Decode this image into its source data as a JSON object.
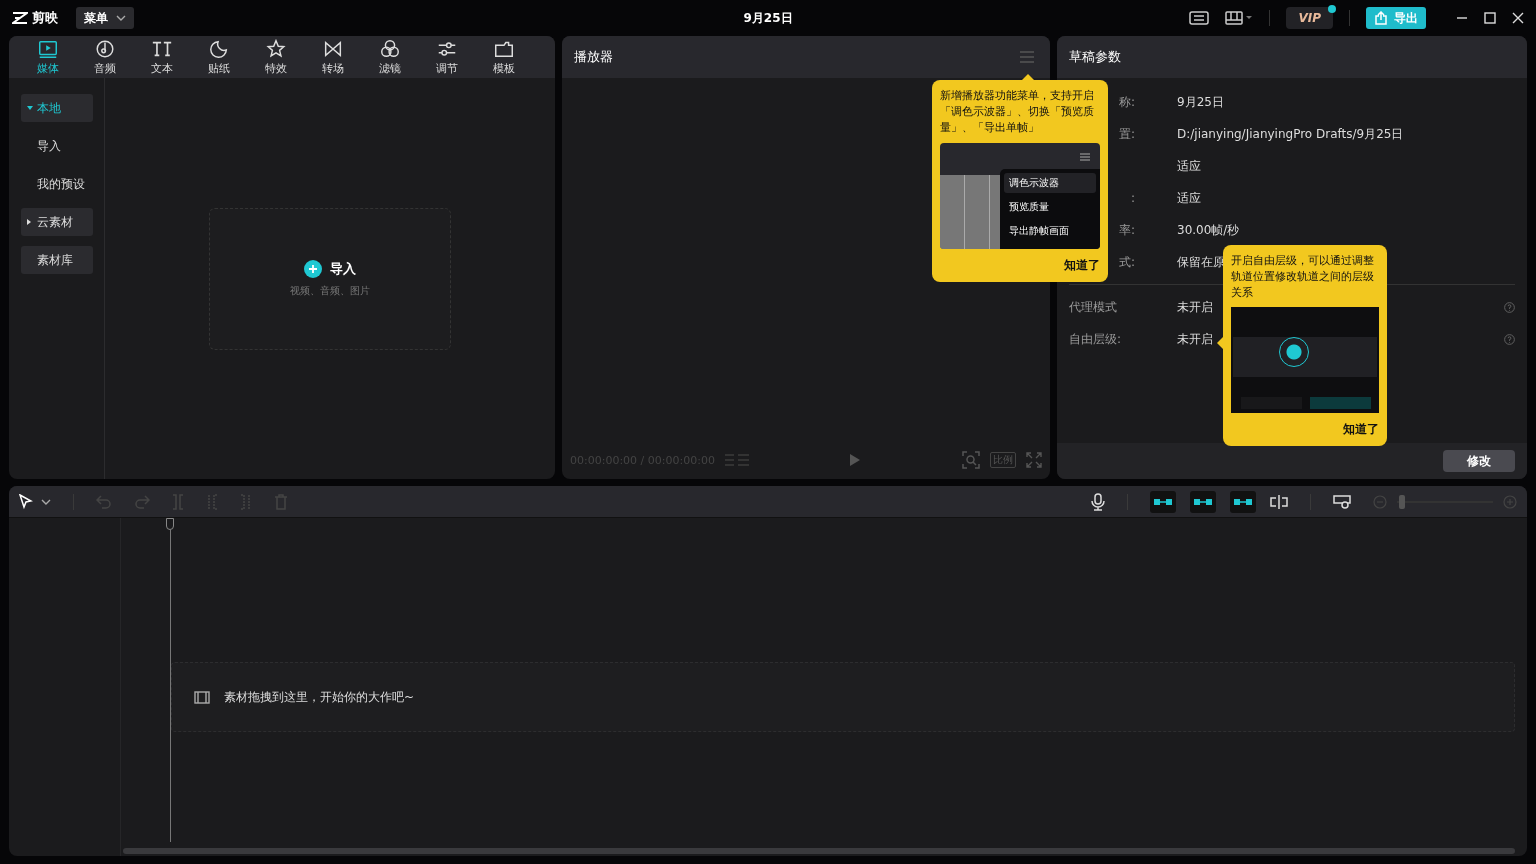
{
  "app": {
    "logo_text": "剪映",
    "menu_button": "菜单",
    "title": "9月25日",
    "export_button": "导出",
    "vip_label": "VIP",
    "vip_dot": true
  },
  "media_tabs": [
    {
      "label": "媒体",
      "selected": true
    },
    {
      "label": "音频",
      "selected": false
    },
    {
      "label": "文本",
      "selected": false
    },
    {
      "label": "贴纸",
      "selected": false
    },
    {
      "label": "特效",
      "selected": false
    },
    {
      "label": "转场",
      "selected": false
    },
    {
      "label": "滤镜",
      "selected": false
    },
    {
      "label": "调节",
      "selected": false
    },
    {
      "label": "模板",
      "selected": false
    }
  ],
  "media_sidebar": [
    {
      "label": "本地",
      "kind": "group",
      "selected": true,
      "expanded": true
    },
    {
      "label": "导入",
      "kind": "item",
      "selected": false
    },
    {
      "label": "我的预设",
      "kind": "item",
      "selected": false
    },
    {
      "label": "云素材",
      "kind": "group",
      "selected": false,
      "expanded": false
    },
    {
      "label": "素材库",
      "kind": "group",
      "selected": false
    }
  ],
  "import_area": {
    "title": "导入",
    "hint": "视频、音频、图片"
  },
  "player": {
    "title": "播放器",
    "timecode": "00:00:00:00 / 00:00:00:00",
    "ratio_button": "比例"
  },
  "player_tip": {
    "text": "新增播放器功能菜单，支持开启「调色示波器」、切换「预览质量」、「导出单帧」",
    "menu": [
      "调色示波器",
      "预览质量",
      "导出静帧画面"
    ],
    "dismiss": "知道了"
  },
  "draft": {
    "title": "草稿参数",
    "params": [
      {
        "label": "称:",
        "value": "9月25日"
      },
      {
        "label": "置:",
        "value": "D:/jianying/JianyingPro Drafts/9月25日"
      },
      {
        "value": "适应"
      },
      {
        "label": ":",
        "value": "适应"
      },
      {
        "label": "率:",
        "value": "30.00帧/秒"
      },
      {
        "label": "式:",
        "value": "保留在原"
      }
    ],
    "options": [
      {
        "label": "代理模式",
        "value": "未开启"
      },
      {
        "label": "自由层级:",
        "value": "未开启"
      }
    ],
    "edit_button": "修改"
  },
  "layer_tip": {
    "text": "开启自由层级，可以通过调整轨道位置修改轨道之间的层级关系",
    "dismiss": "知道了"
  },
  "timeline": {
    "empty_hint": "素材拖拽到这里，开始你的大作吧~",
    "toggles": [
      {
        "on": true
      },
      {
        "on": true
      },
      {
        "on": true
      }
    ],
    "zoom": {
      "level": 0.02
    }
  }
}
